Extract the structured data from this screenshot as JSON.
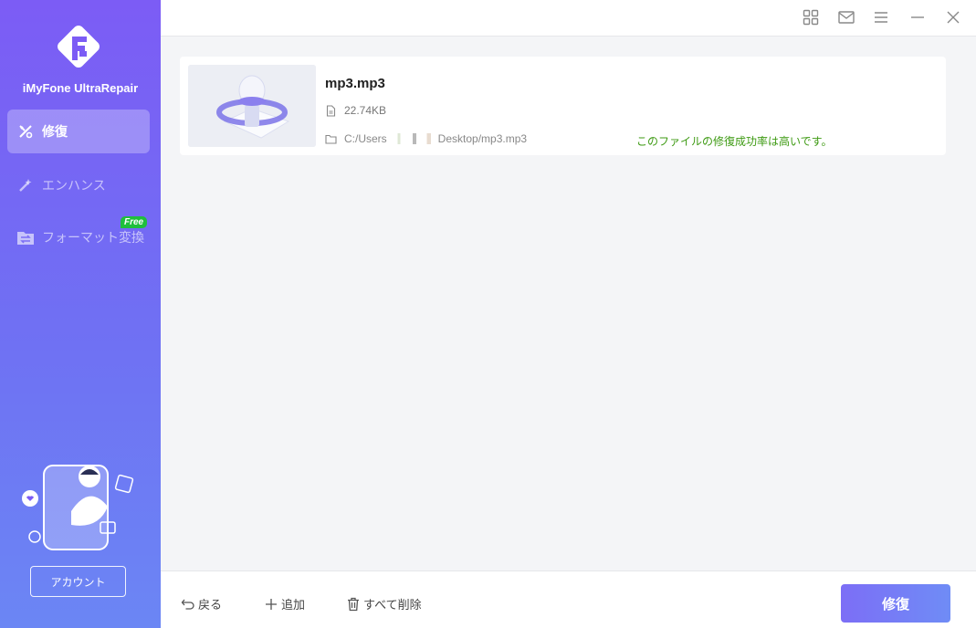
{
  "app": {
    "name": "iMyFone UltraRepair"
  },
  "sidebar": {
    "items": [
      {
        "label": "修復",
        "icon": "repair-tools-icon",
        "active": true
      },
      {
        "label": "エンハンス",
        "icon": "magic-wand-icon",
        "active": false
      },
      {
        "label": "フォーマット変換",
        "icon": "convert-folder-icon",
        "active": false,
        "badge": "Free"
      }
    ],
    "account_label": "アカウント"
  },
  "titlebar": {
    "icons": [
      "grid-icon",
      "mail-icon",
      "menu-icon",
      "minimize-icon",
      "close-icon"
    ]
  },
  "file": {
    "name": "mp3.mp3",
    "size": "22.74KB",
    "path_prefix": "C:/Users",
    "path_suffix": "Desktop/mp3.mp3",
    "status": "このファイルの修復成功率は高いです。"
  },
  "bottombar": {
    "back_label": "戻る",
    "add_label": "追加",
    "delete_all_label": "すべて削除",
    "repair_label": "修復"
  },
  "colors": {
    "accent": "#7c5cf5",
    "success": "#3d9a12",
    "badge": "#1fbf3c"
  }
}
